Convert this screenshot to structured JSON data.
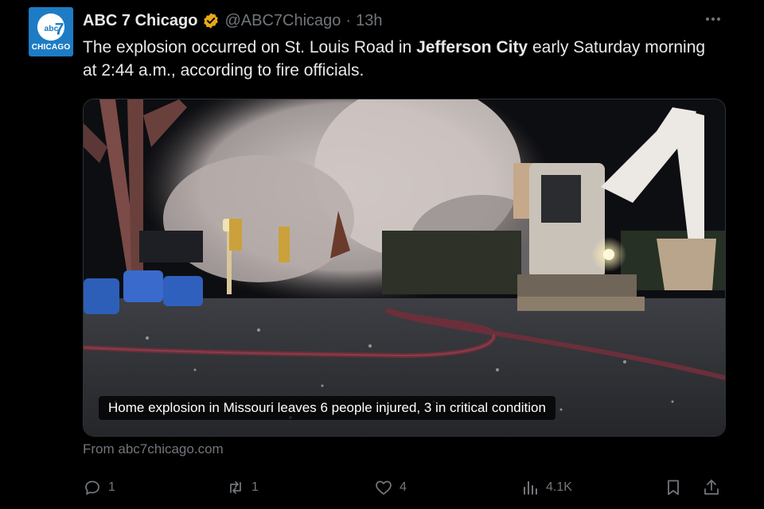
{
  "account": {
    "name": "ABC 7 Chicago",
    "handle": "@ABC7Chicago",
    "separator": "·",
    "time": "13h",
    "avatar_text": "abc",
    "avatar_number": "7",
    "avatar_sub": "CHICAGO"
  },
  "post": {
    "text_part1": "The explosion occurred on St. Louis Road in ",
    "text_bold": "Jefferson City",
    "text_part2": " early Saturday morning at 2:44 a.m., according to fire officials."
  },
  "media": {
    "caption": "Home explosion in Missouri leaves 6 people injured, 3 in critical condition"
  },
  "source": "From abc7chicago.com",
  "actions": {
    "replies": "1",
    "reposts": "1",
    "likes": "4",
    "views": "4.1K"
  },
  "icons": {
    "verified": "verified-badge-icon",
    "more": "more-options-icon",
    "reply": "reply-icon",
    "repost": "repost-icon",
    "like": "heart-icon",
    "views": "views-chart-icon",
    "bookmark": "bookmark-icon",
    "share": "share-icon"
  },
  "colors": {
    "background": "#000000",
    "text": "#e7e9ea",
    "muted": "#71767b",
    "verified": "#e8a81a",
    "avatar": "#1d7cc4"
  }
}
